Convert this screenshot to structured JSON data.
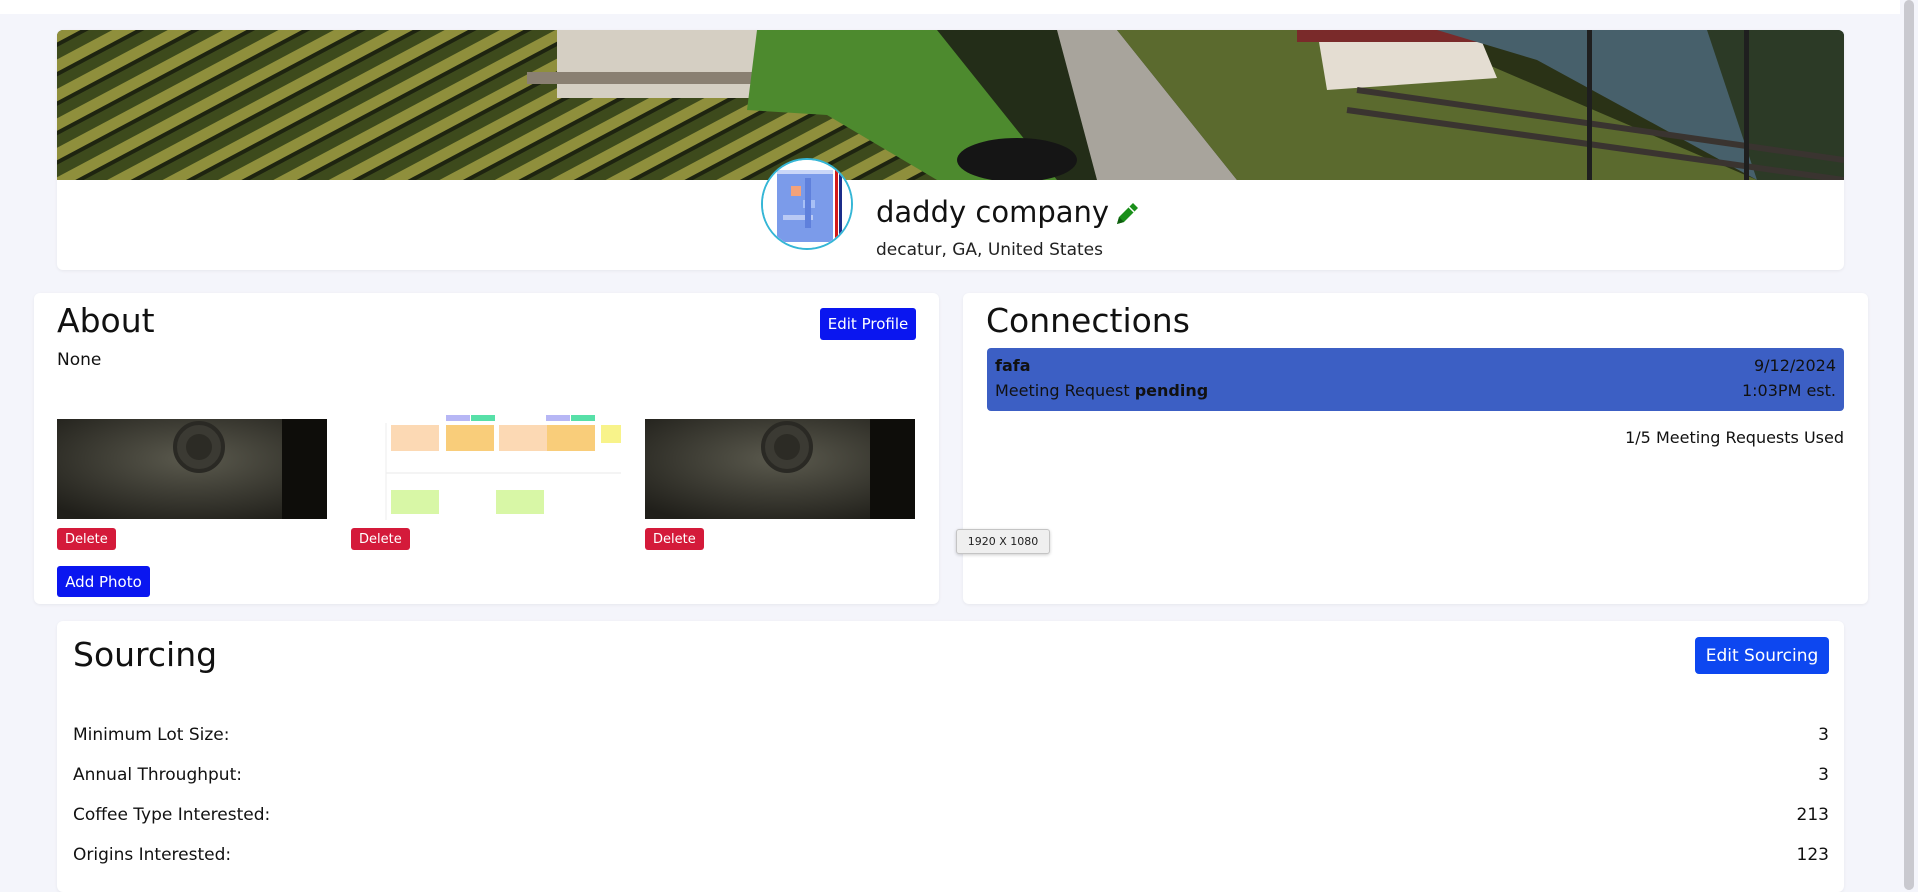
{
  "header": {
    "company_name": "daddy company",
    "location": "decatur, GA, United States"
  },
  "about": {
    "title": "About",
    "text": "None",
    "edit_button": "Edit Profile",
    "delete_label": "Delete",
    "add_photo": "Add Photo"
  },
  "connections": {
    "title": "Connections",
    "items": [
      {
        "name": "fafa",
        "request_prefix": "Meeting Request",
        "status": "pending",
        "date": "9/12/2024",
        "time": "1:03PM est."
      }
    ],
    "usage": "1/5 Meeting Requests Used"
  },
  "tooltip": "1920 X 1080",
  "sourcing": {
    "title": "Sourcing",
    "edit_button": "Edit Sourcing",
    "rows": [
      {
        "label": "Minimum Lot Size:",
        "value": "3"
      },
      {
        "label": "Annual Throughput:",
        "value": "3"
      },
      {
        "label": "Coffee Type Interested:",
        "value": "213"
      },
      {
        "label": "Origins Interested:",
        "value": "123"
      }
    ]
  },
  "colors": {
    "primary_button": "#0a16f0",
    "delete_button": "#d41a3a",
    "connection_item": "#3c5fc4",
    "edit_icon": "#1a8f1a"
  },
  "icons": {
    "edit_name": "pencil-icon"
  }
}
